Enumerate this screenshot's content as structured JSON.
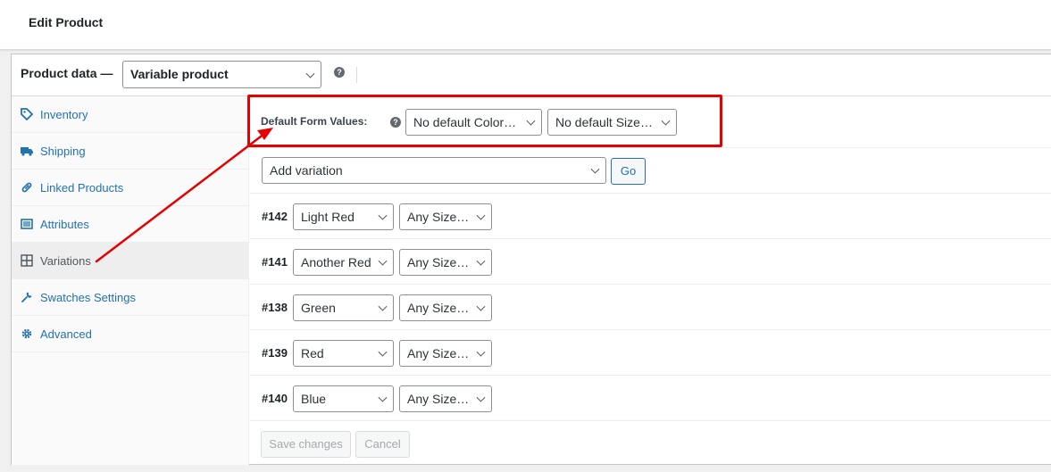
{
  "header": {
    "title": "Edit Product"
  },
  "product_data": {
    "label": "Product data —",
    "type_value": "Variable product",
    "help": "?"
  },
  "tabs": [
    {
      "label": "Inventory",
      "icon": "inventory-tag-icon"
    },
    {
      "label": "Shipping",
      "icon": "truck-icon"
    },
    {
      "label": "Linked Products",
      "icon": "link-icon"
    },
    {
      "label": "Attributes",
      "icon": "list-icon"
    },
    {
      "label": "Variations",
      "icon": "grid-icon",
      "active": true
    },
    {
      "label": "Swatches Settings",
      "icon": "wrench-icon"
    },
    {
      "label": "Advanced",
      "icon": "gear-icon"
    }
  ],
  "default_form": {
    "label": "Default Form Values:",
    "help": "?",
    "color_value": "No default Color…",
    "size_value": "No default Size…"
  },
  "add_variation": {
    "value": "Add variation",
    "go_label": "Go"
  },
  "variations": [
    {
      "id": "#142",
      "color": "Light Red",
      "size": "Any Size…"
    },
    {
      "id": "#141",
      "color": "Another Red",
      "size": "Any Size…"
    },
    {
      "id": "#138",
      "color": "Green",
      "size": "Any Size…"
    },
    {
      "id": "#139",
      "color": "Red",
      "size": "Any Size…"
    },
    {
      "id": "#140",
      "color": "Blue",
      "size": "Any Size…"
    }
  ],
  "actions": {
    "save_label": "Save changes",
    "cancel_label": "Cancel"
  },
  "annotation": {
    "color": "#e60000"
  }
}
